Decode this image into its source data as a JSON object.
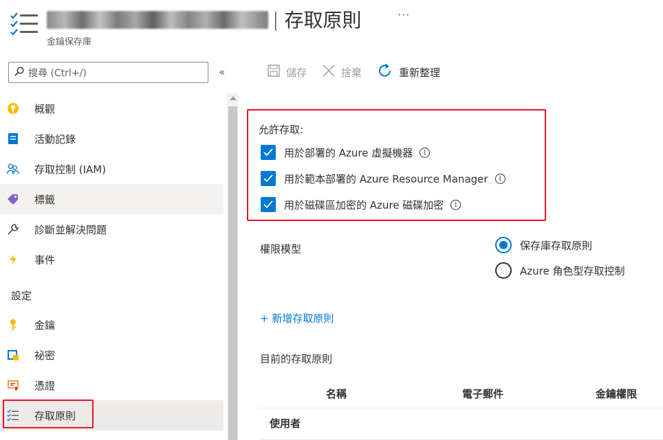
{
  "header": {
    "resource_name": "fabeorecordingbot-kv",
    "separator": "|",
    "page_title": "存取原則",
    "more": "···",
    "subtitle": "金鑰保存庫"
  },
  "sidebar": {
    "search_placeholder": "搜尋 (Ctrl+/)",
    "collapse": "«",
    "items": [
      {
        "label": "概觀",
        "icon": "overview-icon"
      },
      {
        "label": "活動記錄",
        "icon": "activity-log-icon"
      },
      {
        "label": "存取控制 (IAM)",
        "icon": "iam-icon"
      },
      {
        "label": "標籤",
        "icon": "tag-icon"
      },
      {
        "label": "診斷並解決問題",
        "icon": "wrench-icon"
      },
      {
        "label": "事件",
        "icon": "lightning-icon"
      }
    ],
    "section_settings": "設定",
    "settings_items": [
      {
        "label": "金鑰",
        "icon": "key-icon"
      },
      {
        "label": "祕密",
        "icon": "secret-icon"
      },
      {
        "label": "憑證",
        "icon": "certificate-icon"
      },
      {
        "label": "存取原則",
        "icon": "access-policy-icon"
      }
    ]
  },
  "toolbar": {
    "save": "儲存",
    "discard": "捨棄",
    "refresh": "重新整理"
  },
  "access": {
    "title": "允許存取:",
    "options": [
      {
        "label": "用於部署的 Azure 虛擬機器",
        "checked": true
      },
      {
        "label": "用於範本部署的 Azure Resource Manager",
        "checked": true
      },
      {
        "label": "用於磁碟區加密的 Azure 磁碟加密",
        "checked": true
      }
    ]
  },
  "permission_model": {
    "label": "權限模型",
    "options": [
      {
        "label": "保存庫存取原則",
        "selected": true
      },
      {
        "label": "Azure 角色型存取控制",
        "selected": false
      }
    ]
  },
  "add_policy": "+ 新增存取原則",
  "current_policies": {
    "title": "目前的存取原則",
    "columns": [
      "名稱",
      "電子郵件",
      "金鑰權限"
    ],
    "group_row": "使用者"
  },
  "colors": {
    "accent": "#0078d4",
    "highlight": "#e81123"
  }
}
